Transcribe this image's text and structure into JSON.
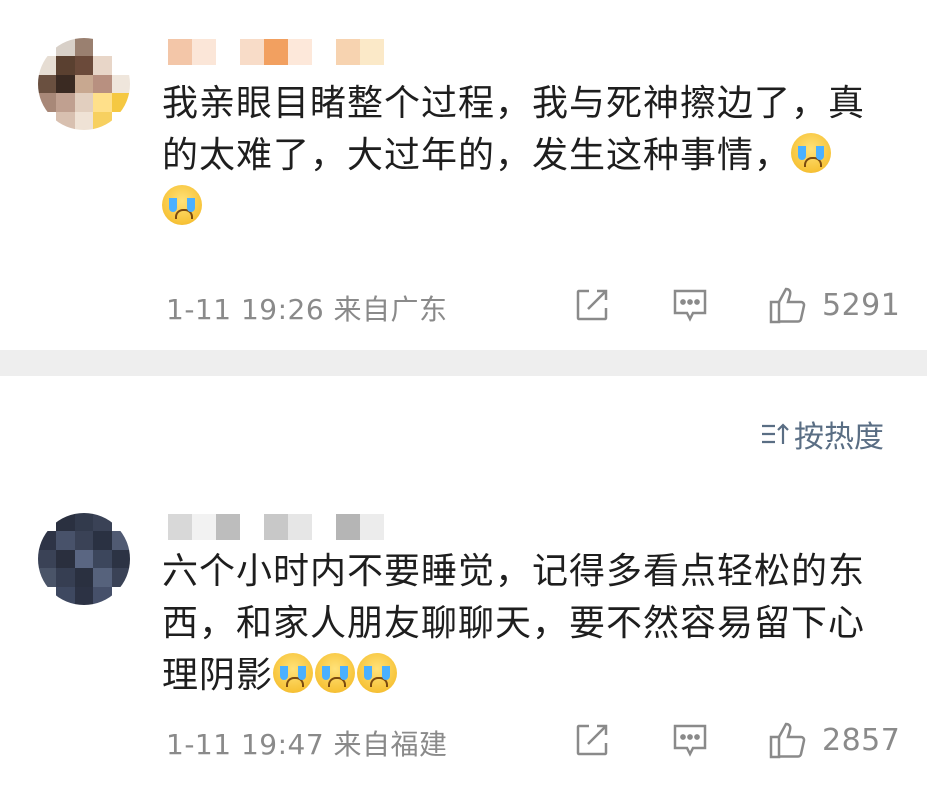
{
  "comments": [
    {
      "text": "我亲眼目睹整个过程，我与死神擦边了，真的太难了，大过年的，发生这种事情，",
      "emoji_count": 2,
      "time": "1-11 19:26",
      "location": "来自广东",
      "likes": "5291"
    },
    {
      "text": "六个小时内不要睡觉，记得多看点轻松的东西，和家人朋友聊聊天，要不然容易留下心理阴影",
      "emoji_count": 3,
      "time": "1-11 19:47",
      "location": "来自福建",
      "likes": "2857"
    }
  ],
  "sort": {
    "label": "按热度"
  },
  "icons": {
    "share": "share-icon",
    "reply": "comment-icon",
    "like": "thumbs-up-icon",
    "sort": "sort-icon",
    "emoji": "crying-face-icon"
  },
  "colors": {
    "text": "#1e1e1e",
    "meta": "#8a8a8a",
    "divider": "#eeeeee",
    "sort": "#5a6e84"
  }
}
